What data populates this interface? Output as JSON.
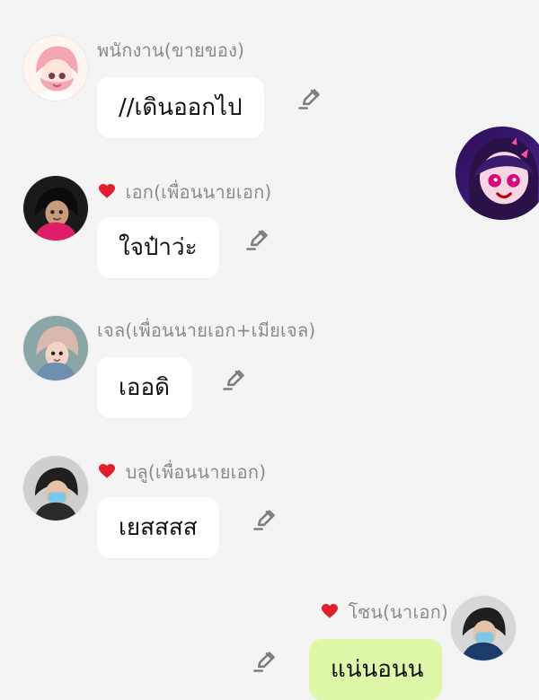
{
  "messages": [
    {
      "sender": "พนักงาน(ขายของ)",
      "text": "//เดินออกไป",
      "favorite": false
    },
    {
      "sender": "เอก(เพื่อนนายเอก)",
      "text": "ใจป๋าว่ะ",
      "favorite": true
    },
    {
      "sender": "เจล(เพื่อนนายเอก+เมียเจล)",
      "text": "เออดิ",
      "favorite": false
    },
    {
      "sender": "บลู(เพื่อนนายเอก)",
      "text": "เยสสสส",
      "favorite": true
    },
    {
      "sender": "โซน(นาเอก)",
      "text": "แน่นอนน",
      "favorite": true
    }
  ],
  "colors": {
    "background": "#f4f4f4",
    "bubble_received": "#ffffff",
    "bubble_sent": "#dff7a8",
    "name_text": "#8b8b8b",
    "heart": "#e11d2e"
  },
  "icons": {
    "edit": "pencil-icon",
    "favorite": "heart-icon"
  }
}
